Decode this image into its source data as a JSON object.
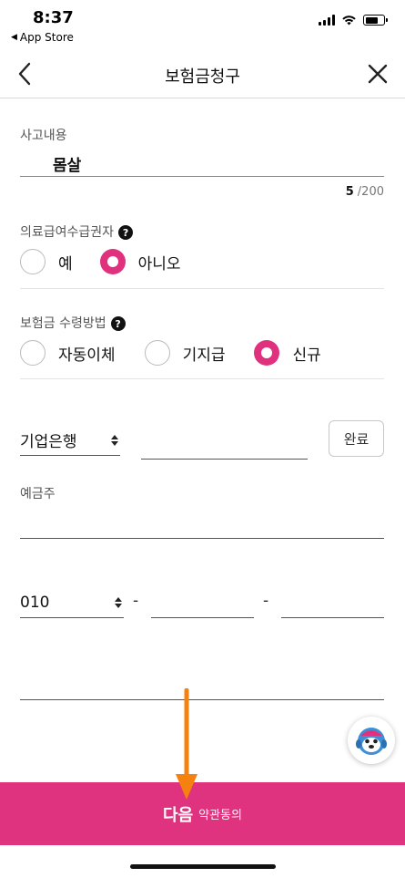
{
  "status_bar": {
    "time": "8:37",
    "back_app": "App Store"
  },
  "header": {
    "title": "보험금청구",
    "back_icon": "chevron-left-icon",
    "close_icon": "close-icon"
  },
  "accident": {
    "label": "사고내용",
    "value": "몸살",
    "count": "5",
    "max": "/200"
  },
  "medical_aid": {
    "label": "의료급여수급권자",
    "options": [
      "예",
      "아니오"
    ],
    "selected": "아니오"
  },
  "payment_method": {
    "label": "보험금 수령방법",
    "options": [
      "자동이체",
      "기지급",
      "신규"
    ],
    "selected": "신규"
  },
  "bank": {
    "selected": "기업은행",
    "account_value": "",
    "done_label": "완료"
  },
  "depositor": {
    "label": "예금주",
    "value": ""
  },
  "phone": {
    "prefix": "010",
    "separator": "-",
    "middle": "",
    "last": ""
  },
  "footer": {
    "next_label": "다음",
    "next_sub": "약관동의"
  },
  "colors": {
    "accent": "#e0317e",
    "annotation_arrow": "#f5820e"
  }
}
